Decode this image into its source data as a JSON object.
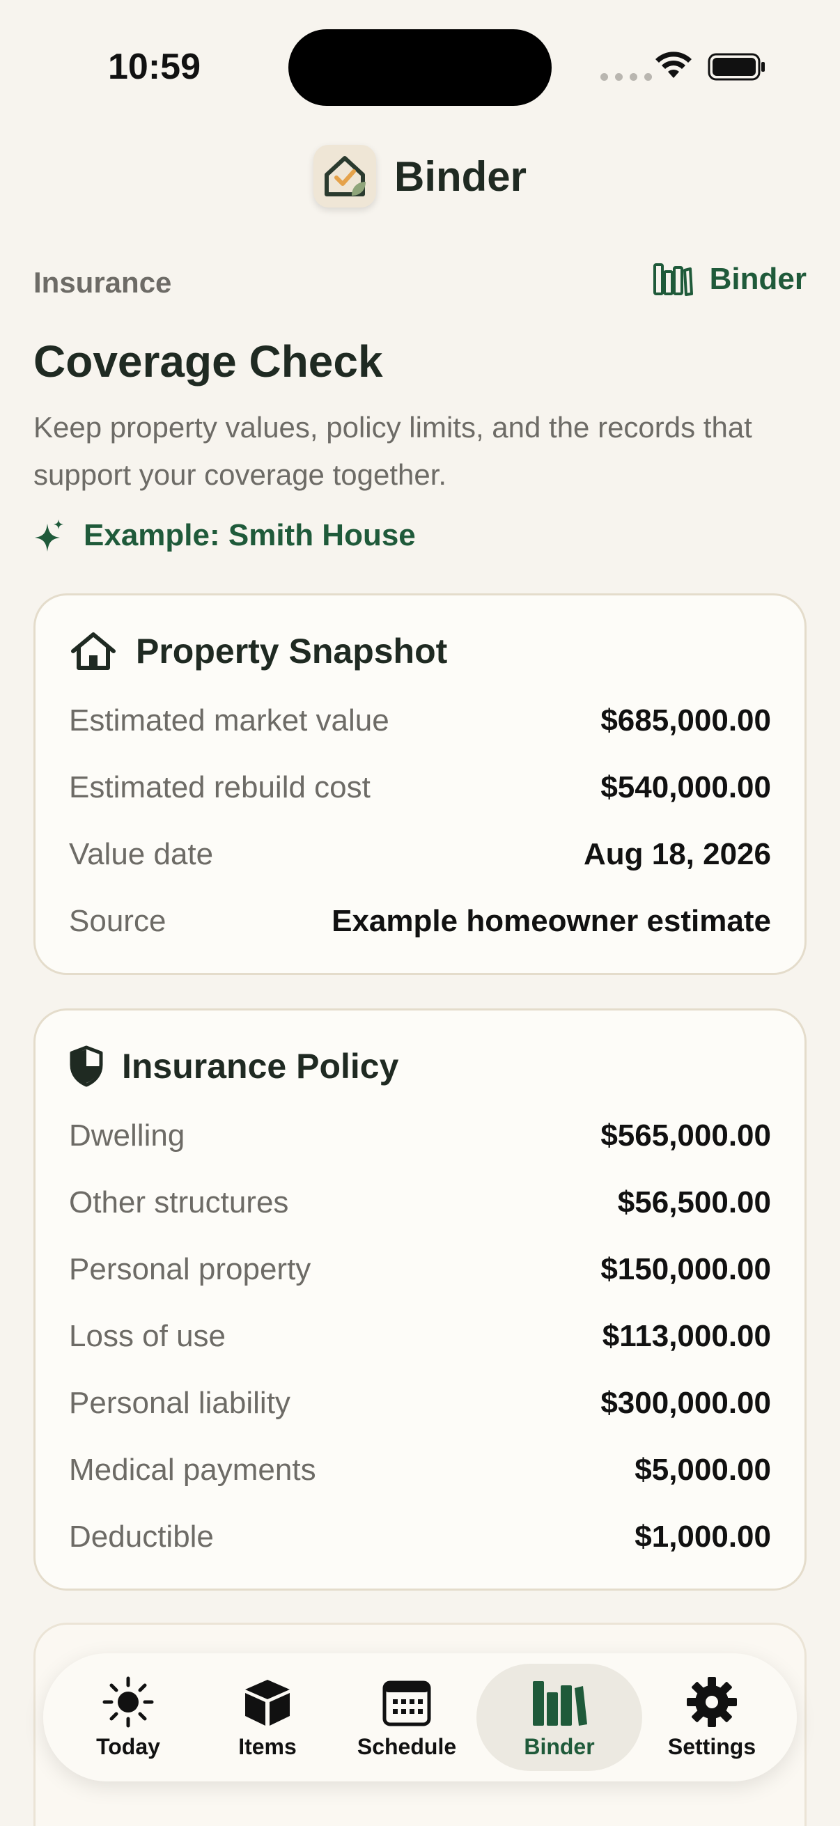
{
  "status_bar": {
    "time": "10:59"
  },
  "header": {
    "app_name": "Binder"
  },
  "top_row": {
    "section_label": "Insurance",
    "binder_link_label": "Binder"
  },
  "page": {
    "title": "Coverage Check",
    "description": "Keep property values, policy limits, and the records that support your coverage together.",
    "example_label": "Example: Smith House"
  },
  "property_snapshot": {
    "title": "Property Snapshot",
    "rows": [
      {
        "label": "Estimated market value",
        "value": "$685,000.00"
      },
      {
        "label": "Estimated rebuild cost",
        "value": "$540,000.00"
      },
      {
        "label": "Value date",
        "value": "Aug 18, 2026"
      },
      {
        "label": "Source",
        "value": "Example homeowner estimate"
      }
    ]
  },
  "insurance_policy": {
    "title": "Insurance Policy",
    "rows": [
      {
        "label": "Dwelling",
        "value": "$565,000.00"
      },
      {
        "label": "Other structures",
        "value": "$56,500.00"
      },
      {
        "label": "Personal property",
        "value": "$150,000.00"
      },
      {
        "label": "Loss of use",
        "value": "$113,000.00"
      },
      {
        "label": "Personal liability",
        "value": "$300,000.00"
      },
      {
        "label": "Medical payments",
        "value": "$5,000.00"
      },
      {
        "label": "Deductible",
        "value": "$1,000.00"
      }
    ]
  },
  "tab_bar": {
    "tabs": [
      {
        "label": "Today",
        "icon": "sun-icon"
      },
      {
        "label": "Items",
        "icon": "box-icon"
      },
      {
        "label": "Schedule",
        "icon": "calendar-icon"
      },
      {
        "label": "Binder",
        "icon": "books-icon",
        "active": true
      },
      {
        "label": "Settings",
        "icon": "gear-icon"
      }
    ]
  },
  "colors": {
    "accent": "#1f5a3a",
    "background": "#f7f4ee",
    "card": "#fdfcf8",
    "card_border": "#e4dccb"
  }
}
